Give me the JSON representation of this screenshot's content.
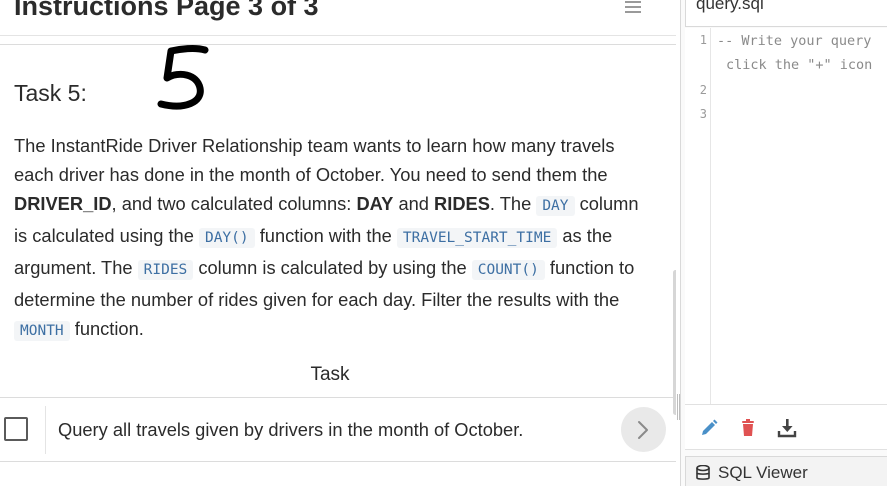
{
  "instructions": {
    "page_title": "Instructions Page 3 of 3",
    "task_heading": "Task 5:",
    "paragraph": {
      "s1": "The InstantRide Driver Relationship team wants to learn how many travels each driver has done in the month of October. You need to send them the ",
      "b1": "DRIVER_ID",
      "s2": ", and two calculated columns: ",
      "b2": "DAY",
      "s3": " and ",
      "b3": "RIDES",
      "s4": ". The ",
      "c1": "DAY",
      "s5": " column is calculated using the ",
      "c2": "DAY()",
      "s6": " function with the ",
      "c3": "TRAVEL_START_TIME",
      "s7": " as the argument. The ",
      "c4": "RIDES",
      "s8": " column is calculated by using the ",
      "c5": "COUNT()",
      "s9": " function to determine the number of rides given for each day. Filter the results with the ",
      "c6": "MONTH",
      "s10": " function."
    },
    "task_section_label": "Task",
    "task_item": {
      "text": "Query all travels given by drivers in the month of October.",
      "checked": false
    }
  },
  "editor": {
    "file_tab": "query.sql",
    "lines": [
      {
        "num": "1",
        "text": "-- Write your query"
      },
      {
        "cont": "click the \"+\" icon"
      },
      {
        "num": "2",
        "text": ""
      },
      {
        "num": "3",
        "text": ""
      }
    ],
    "toolbar": [
      "pencil-icon",
      "trash-icon",
      "download-icon"
    ],
    "viewer_label": "SQL Viewer"
  },
  "colors": {
    "code_text": "#3d6fa3",
    "code_bg": "#f3f5f7",
    "edit": "#4a90c8",
    "delete": "#e05252",
    "download": "#444444"
  }
}
